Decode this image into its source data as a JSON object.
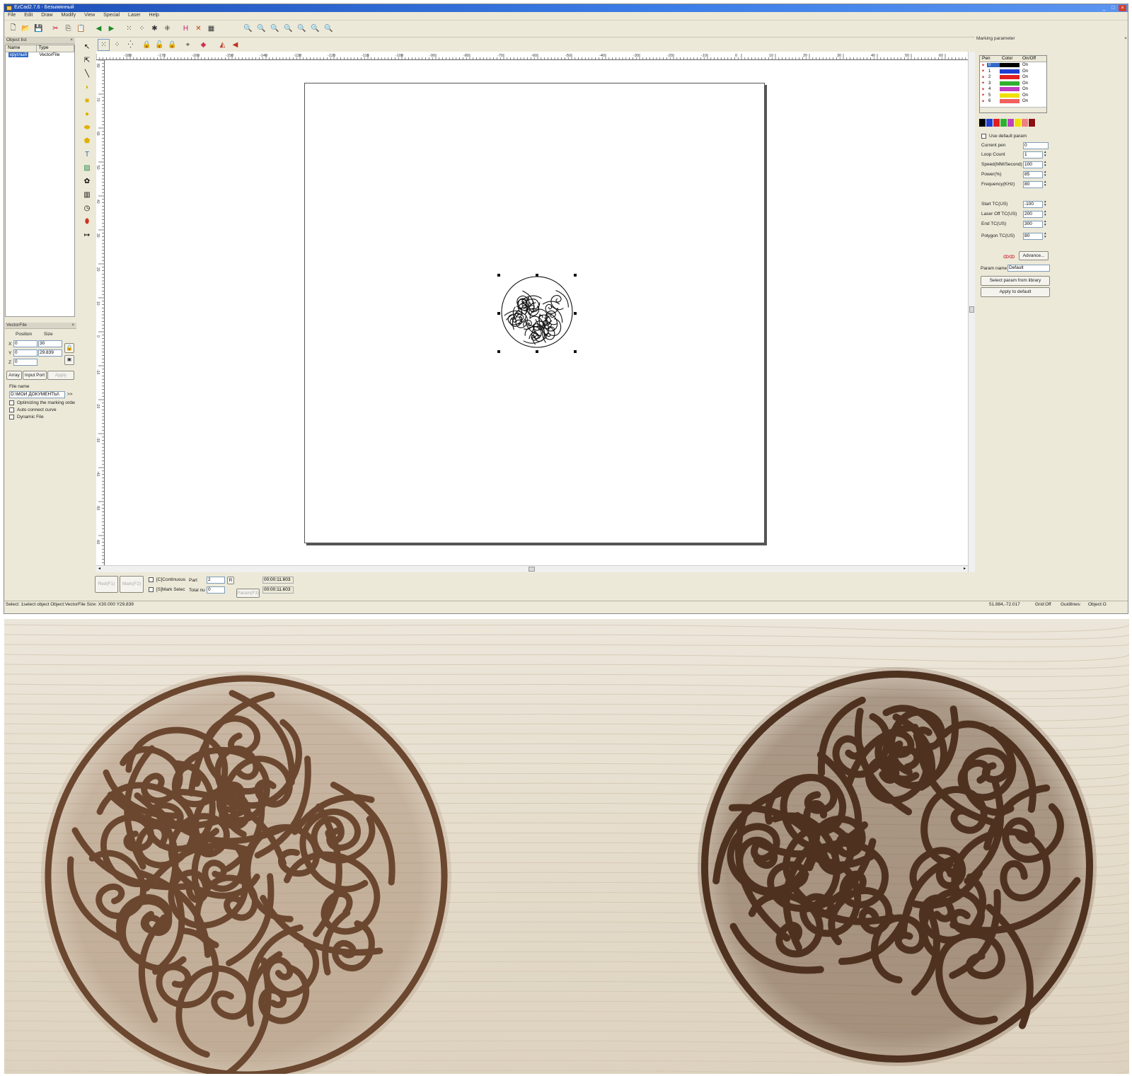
{
  "window": {
    "title": "EzCad2.7.6 - Безымянный",
    "controls": [
      "_",
      "□",
      "×"
    ]
  },
  "menu": [
    "File",
    "Edit",
    "Draw",
    "Modify",
    "View",
    "Special",
    "Laser",
    "Help"
  ],
  "object_list": {
    "title": "Object list",
    "columns": [
      "Name",
      "Type"
    ],
    "rows": [
      {
        "name": "круглый",
        "type": "VectorFile"
      }
    ]
  },
  "vector_panel": {
    "title": "VectorFile",
    "position_label": "Position",
    "size_label": "Size",
    "x_label": "X",
    "y_label": "Y",
    "z_label": "Z",
    "x_pos": "0",
    "y_pos": "0",
    "z_pos": "0",
    "x_size": "30",
    "y_size": "29.839",
    "array_button": "Array",
    "input_port_button": "Input Port",
    "apply_button": "Apply",
    "file_name_label": "File name",
    "file_name_value": "D:\\МОИ ДОКУМЕНТЫ\\",
    "browse_button": ">>",
    "opt_order": "Optimizing the marking order",
    "opt_auto": "Auto connect curve",
    "opt_dynamic": "Dynamic File"
  },
  "bottom": {
    "red_button": "Red(F1)",
    "mark_button": "Mark(F2)",
    "continuous_label": "[C]Continuous",
    "mark_select_label": "[S]Mark Selec",
    "part_label": "Part",
    "part_value": "2",
    "total_label": "Total nu",
    "total_value": "0",
    "r_button": "R",
    "param_button": "Param(F3)",
    "time1": "00:00:11.603",
    "time2": "00:00:11.603"
  },
  "status": {
    "left": "Select: 1select object Object:VectorFile Size: X30.000 Y29.839",
    "coords": "51.884,-72.017",
    "grid": "Grid:Off",
    "guidlines": "Guidlines:",
    "object": "Object:O"
  },
  "marking": {
    "title": "Marking parameter",
    "pen_cols": [
      "Pen",
      "Color",
      "On/Off"
    ],
    "pens": [
      {
        "id": "0",
        "color": "#000000",
        "state": "On"
      },
      {
        "id": "1",
        "color": "#1f3fcf",
        "state": "On"
      },
      {
        "id": "2",
        "color": "#e02020",
        "state": "On"
      },
      {
        "id": "3",
        "color": "#30b030",
        "state": "On"
      },
      {
        "id": "4",
        "color": "#c040c0",
        "state": "On"
      },
      {
        "id": "5",
        "color": "#f0e000",
        "state": "On"
      },
      {
        "id": "6",
        "color": "#f06060",
        "state": "On"
      }
    ],
    "swatches": [
      "#000000",
      "#1f3fcf",
      "#e02020",
      "#30b030",
      "#c040c0",
      "#f0e000",
      "#f08080",
      "#8b1010"
    ],
    "use_default": "Use default param",
    "params": [
      {
        "label": "Current pen",
        "value": "0"
      },
      {
        "label": "Loop Count",
        "value": "1"
      },
      {
        "label": "Speed(MM/Second)",
        "value": "100"
      },
      {
        "label": "Power(%)",
        "value": "85"
      },
      {
        "label": "Frequency(KHz)",
        "value": "80"
      },
      {
        "label": "Start TC(US)",
        "value": "-100"
      },
      {
        "label": "Laser Off TC(US)",
        "value": "200"
      },
      {
        "label": "End TC(US)",
        "value": "300"
      },
      {
        "label": "Polygon TC(US)",
        "value": "80"
      }
    ],
    "advance_button": "Advance...",
    "param_name_label": "Param name",
    "param_name_value": "Default",
    "select_lib_button": "Select param from library",
    "apply_default_button": "Apply to default"
  },
  "ruler_h": [
    "-180",
    "-170",
    "-160",
    "-150",
    "-140",
    "-130",
    "-120",
    "-110",
    "-100",
    "-90",
    "-80",
    "-70",
    "-60",
    "-50",
    "-40",
    "-30",
    "-20",
    "-10",
    "0",
    "10",
    "20",
    "30",
    "40",
    "50",
    "60",
    "70",
    "80",
    "90",
    "100",
    "110",
    "120",
    "130",
    "140",
    "150",
    "160",
    "170",
    "180"
  ],
  "ruler_v": [
    "80",
    "70",
    "60",
    "50",
    "40",
    "30",
    "20",
    "10",
    "0",
    "-10",
    "-20",
    "-30",
    "-40",
    "-50",
    "-60",
    "-70",
    "-80",
    "-90",
    "-100",
    "-110"
  ],
  "colors": {
    "selection": "#316ac5",
    "wood": "#e6ddcc",
    "engrave": "#6b4730"
  }
}
